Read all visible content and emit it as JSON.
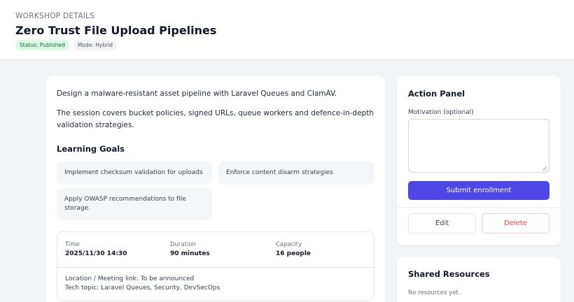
{
  "header": {
    "eyebrow": "WORKSHOP DETAILS",
    "title": "Zero Trust File Upload Pipelines",
    "status_badge": "Status: Published",
    "mode_badge": "Mode: Hybrid"
  },
  "main": {
    "description_1": "Design a malware-resistant asset pipeline with Laravel Queues and ClamAV.",
    "description_2": "The session covers bucket policies, signed URLs, queue workers and defence-in-depth validation strategies.",
    "goals_title": "Learning Goals",
    "goals": [
      "Implement checksum validation for uploads",
      "Enforce content disarm strategies",
      "Apply OWASP recommendations to file storage."
    ],
    "meta": {
      "time_label": "Time",
      "time_value": "2025/11/30 14:30",
      "duration_label": "Duration",
      "duration_value": "90 minutes",
      "capacity_label": "Capacity",
      "capacity_value": "16 people",
      "location": "Location / Meeting link: To be announced",
      "tech_topic": "Tech topic: Laravel Queues, Security, DevSecOps"
    }
  },
  "action_panel": {
    "title": "Action Panel",
    "motivation_label": "Motivation (optional)",
    "motivation_value": "",
    "submit_label": "Submit enrollment",
    "edit_label": "Edit",
    "delete_label": "Delete"
  },
  "shared_resources": {
    "title": "Shared Resources",
    "empty_text": "No resources yet."
  },
  "colors": {
    "accent": "#4f46e5",
    "danger": "#ef4444",
    "status_published_bg": "#dcfce7",
    "status_published_text": "#166534"
  }
}
